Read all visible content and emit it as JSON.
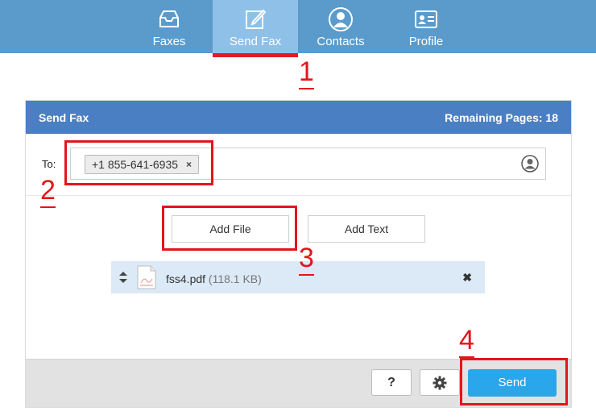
{
  "nav": {
    "items": [
      {
        "label": "Faxes",
        "icon": "inbox-tray-icon"
      },
      {
        "label": "Send Fax",
        "icon": "edit-pencil-icon",
        "active": true
      },
      {
        "label": "Contacts",
        "icon": "user-circle-icon"
      },
      {
        "label": "Profile",
        "icon": "id-card-icon"
      }
    ]
  },
  "annotations": [
    "1",
    "2",
    "3",
    "4"
  ],
  "panel": {
    "title": "Send Fax",
    "remaining_pages": "Remaining Pages: 18"
  },
  "recipient": {
    "label": "To:",
    "chip": "+1 855-641-6935",
    "chip_remove": "×"
  },
  "actions": {
    "add_file": "Add File",
    "add_text": "Add Text"
  },
  "attachment": {
    "name": "fss4.pdf",
    "size": "(118.1 KB)",
    "remove": "✖"
  },
  "footer": {
    "help": "?",
    "send": "Send"
  },
  "colors": {
    "nav_bg": "#5a9bcc",
    "nav_active": "#8fc0e8",
    "panel_header": "#4a7fc3",
    "send_button": "#2aa6ea",
    "annotation_red": "#e3151b"
  }
}
